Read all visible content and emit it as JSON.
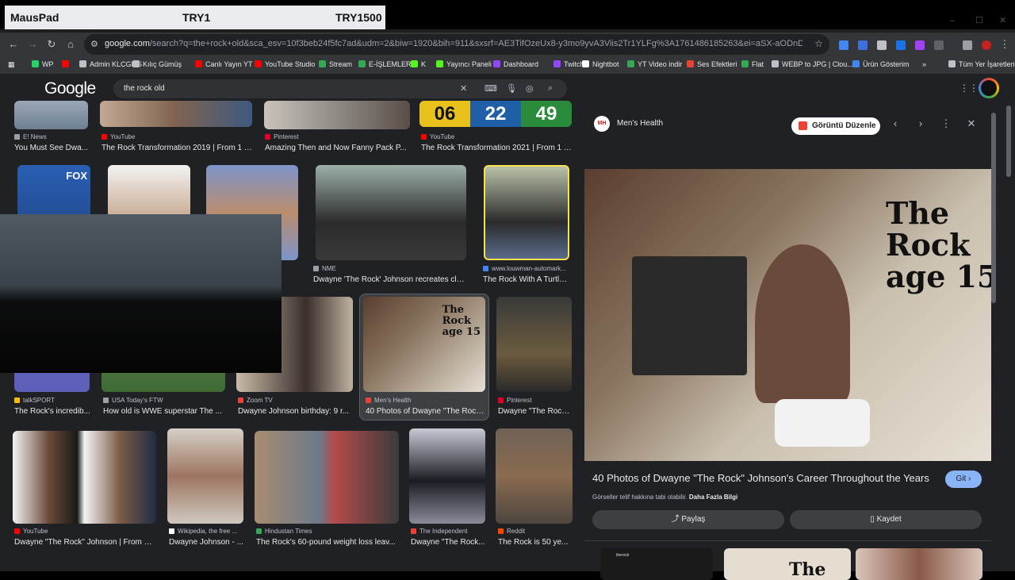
{
  "overlay": {
    "left": "MausPad",
    "mid": "TRY1",
    "right": "TRY1500"
  },
  "browser": {
    "url_prefix": "google.com",
    "url_rest": "/search?q=the+rock+old&sca_esv=10f3beb24f5fc7ad&udm=2&biw=1920&bih=911&sxsrf=AE3TifOzeUx8-y3mo9yvA3Viis2Tr1YLFg%3A1761486185263&ei=aSX-aODnD6-I7NYPy-vBqQE&ved=0ahUKE...",
    "window_controls": [
      "–",
      "☐",
      "✕"
    ]
  },
  "bookmarks": [
    {
      "label": "WP",
      "color": "#25d366"
    },
    {
      "label": "",
      "color": "#ff0000"
    },
    {
      "label": "Admin KLCGMS",
      "color": "#bdc1c6"
    },
    {
      "label": "Kılıç Gümüş",
      "color": "#bdc1c6"
    },
    {
      "label": "Canlı Yayın YT",
      "color": "#ff0000"
    },
    {
      "label": "YouTube Studio",
      "color": "#ff0000"
    },
    {
      "label": "Stream",
      "color": "#34a853"
    },
    {
      "label": "E-İŞLEMLER",
      "color": "#34a853"
    },
    {
      "label": "K",
      "color": "#53fc18"
    },
    {
      "label": "Yayıncı Paneli",
      "color": "#53fc18"
    },
    {
      "label": "Dashboard",
      "color": "#9146ff"
    },
    {
      "label": "Twitch",
      "color": "#9146ff"
    },
    {
      "label": "Nightbot",
      "color": "#ffffff"
    },
    {
      "label": "YT Video indir",
      "color": "#34a853"
    },
    {
      "label": "Ses Efektleri",
      "color": "#ea4335"
    },
    {
      "label": "Flat",
      "color": "#34a853"
    },
    {
      "label": "WEBP to JPG | Clou...",
      "color": "#bdc1c6"
    },
    {
      "label": "Ürün Gösterim",
      "color": "#4285f4"
    },
    {
      "label": "»",
      "color": ""
    },
    {
      "label": "Tüm Yer İşaretleri",
      "color": "#bdc1c6"
    }
  ],
  "google": {
    "logo": "Google",
    "query": "the rock old"
  },
  "results": [
    {
      "src": "E! News",
      "cap": "You Must See Dwa...",
      "sc": "#9aa0a6"
    },
    {
      "src": "YouTube",
      "cap": "The Rock Transformation 2019 | From 1 T...",
      "sc": "#ff0000"
    },
    {
      "src": "Pinterest",
      "cap": "Amazing Then and Now Fanny Pack P...",
      "sc": "#e60023"
    },
    {
      "src": "YouTube",
      "cap": "The Rock Transformation 2021 | From 1 T...",
      "sc": "#ff0000"
    },
    {
      "src": "NME",
      "cap": "Dwayne 'The Rock' Johnson recreates clas...",
      "sc": "#9aa0a6"
    },
    {
      "src": "www.louwman-automark...",
      "cap": "The Rock With A Turtle...",
      "sc": "#4285f4"
    },
    {
      "src": "talkSPORT",
      "cap": "The Rock's incredib...",
      "sc": "#fbbc05"
    },
    {
      "src": "USA Today's FTW",
      "cap": "How old is WWE superstar The ...",
      "sc": "#9aa0a6"
    },
    {
      "src": "Zoom TV",
      "cap": "Dwayne Johnson birthday: 9 r...",
      "sc": "#ea4335"
    },
    {
      "src": "Men's Health",
      "cap": "40 Photos of Dwayne \"The Rock...",
      "sc": "#ea4335"
    },
    {
      "src": "Pinterest",
      "cap": "Dwayne \"The Rock...",
      "sc": "#e60023"
    },
    {
      "src": "YouTube",
      "cap": "Dwayne \"The Rock\" Johnson | From 1 ...",
      "sc": "#ff0000"
    },
    {
      "src": "Wikipedia, the free ...",
      "cap": "Dwayne Johnson - ...",
      "sc": "#ffffff"
    },
    {
      "src": "Hindustan Times",
      "cap": "The Rock's 60-pound weight loss leav...",
      "sc": "#34a853"
    },
    {
      "src": "The Independent",
      "cap": "Dwayne \"The Rock...",
      "sc": "#ea4335"
    },
    {
      "src": "Reddit",
      "cap": "The Rock is 50 ye...",
      "sc": "#ff4500"
    }
  ],
  "thumb_texts": {
    "n1": "06",
    "n2": "22",
    "n3": "49",
    "fox": "FOX"
  },
  "panel": {
    "source": "Men's Health",
    "source_abbr": "MH",
    "edit_button": "Görüntü Düzenle",
    "image_text": "The\nRock\nage 15",
    "title": "40 Photos of Dwayne \"The Rock\" Johnson's Career Throughout the Years",
    "go_button": "Git",
    "copyright": "Görseller telif hakkına tabi olabilir.",
    "learn_more": "Daha Fazla Bilgi",
    "share": "Paylaş",
    "save": "Kaydet",
    "related_caption": "therock",
    "related_text": "The"
  }
}
